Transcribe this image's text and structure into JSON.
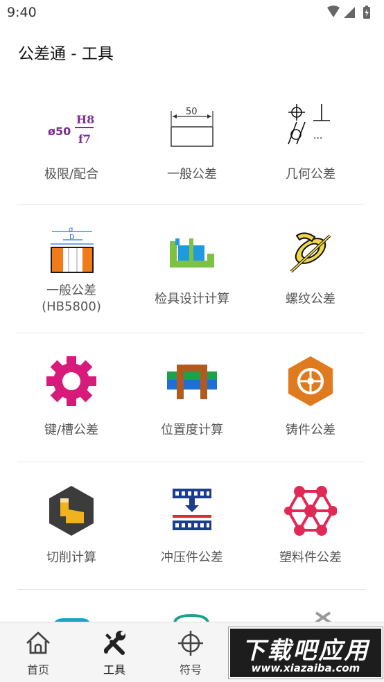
{
  "status_bar": {
    "time": "9:40"
  },
  "header": {
    "title": "公差通 - 工具"
  },
  "tools": [
    {
      "label": "极限/配合",
      "icon": "limits-fits-icon"
    },
    {
      "label": "一般公差",
      "icon": "general-tolerance-icon"
    },
    {
      "label": "几何公差",
      "icon": "geometric-tolerance-icon"
    },
    {
      "label": "一般公差\n(HB5800)",
      "label_line1": "一般公差",
      "label_line2": "(HB5800)",
      "icon": "hb5800-icon"
    },
    {
      "label": "检具设计计算",
      "icon": "gauge-design-icon"
    },
    {
      "label": "螺纹公差",
      "icon": "thread-tolerance-icon"
    },
    {
      "label": "键/槽公差",
      "icon": "key-slot-gear-icon"
    },
    {
      "label": "位置度计算",
      "icon": "position-calc-icon"
    },
    {
      "label": "铸件公差",
      "icon": "casting-tolerance-icon"
    },
    {
      "label": "切削计算",
      "icon": "cutting-calc-icon"
    },
    {
      "label": "冲压件公差",
      "icon": "stamping-tolerance-icon"
    },
    {
      "label": "塑料件公差",
      "icon": "plastic-part-icon"
    }
  ],
  "icon_texts": {
    "fit_diameter": "ø50",
    "fit_hole": "H8",
    "fit_shaft": "f7",
    "dimension": "50",
    "hb_outer": "d",
    "hb_inner": "D",
    "dots": "..."
  },
  "bottom_nav": [
    {
      "label": "首页",
      "icon": "home-icon",
      "active": false
    },
    {
      "label": "工具",
      "icon": "tools-icon",
      "active": true
    },
    {
      "label": "符号",
      "icon": "crosshair-icon",
      "active": false
    }
  ],
  "watermark": {
    "title": "下载吧应用",
    "url": "www.xiazaiba.com"
  },
  "colors": {
    "purple": "#7b2d8e",
    "pink": "#d81b7a",
    "orange": "#e07a1f",
    "green": "#7dc242",
    "blue": "#1e88e5",
    "red": "#e02a55",
    "dark_gray": "#3c3c3c"
  }
}
